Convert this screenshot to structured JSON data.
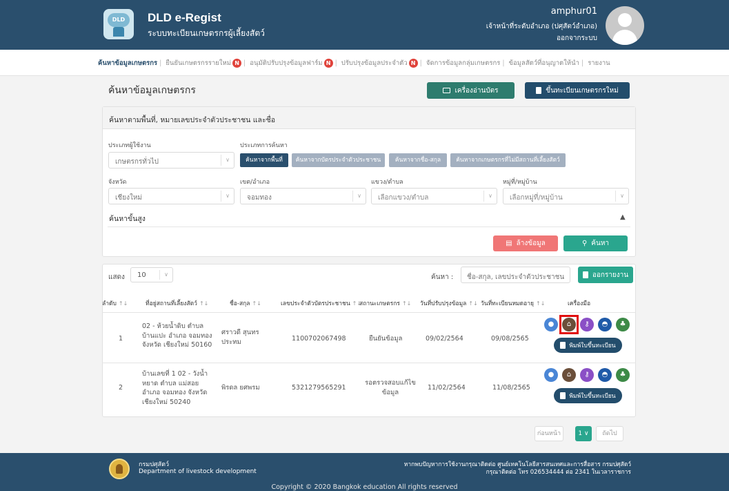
{
  "header": {
    "app_title": "DLD e-Regist",
    "app_subtitle": "ระบบทะเบียนเกษตรกรผู้เลี้ยงสัตว์",
    "logo_text": "DLD",
    "user_name": "amphur01",
    "user_role": "เจ้าหน้าที่ระดับอำเภอ (ปศุสัตว์อำเภอ)",
    "logout": "ออกจากระบบ"
  },
  "nav": {
    "items": [
      {
        "label": "ค้นหาข้อมูลเกษตรกร",
        "badge": ""
      },
      {
        "label": "ยืนยันเกษตรกรรายใหม่",
        "badge": "N"
      },
      {
        "label": "อนุมัติปรับปรุงข้อมูลฟาร์ม",
        "badge": "N"
      },
      {
        "label": "ปรับปรุงข้อมูลประจำตัว",
        "badge": "N"
      },
      {
        "label": "จัดการข้อมูลกลุ่มเกษตรกร",
        "badge": ""
      },
      {
        "label": "ข้อมูลสัตว์ที่อนุญาตให้นำ",
        "badge": ""
      },
      {
        "label": "รายงาน",
        "badge": ""
      }
    ],
    "separator": "|"
  },
  "page": {
    "title": "ค้นหาข้อมูลเกษตรกร",
    "btn_card_reader": "เครื่องอ่านบัตร",
    "btn_register_new": "ขึ้นทะเบียนเกษตรกรใหม่"
  },
  "search_panel": {
    "title": "ค้นหาตามพื้นที่, หมายเลขประจำตัวประชาชน และชื่อ",
    "user_type_label": "ประเภทผู้ใช้งาน",
    "user_type_value": "เกษตรกรทั่วไป",
    "search_type_label": "ประเภทการค้นหา",
    "search_types": [
      "ค้นหาจากพื้นที่",
      "ค้นหาจากบัตรประจำตัวประชาชน",
      "ค้นหาจากชื่อ-สกุล",
      "ค้นหาจากเกษตรกรที่ไม่มีสถานที่เลี้ยงสัตว์"
    ],
    "province_label": "จังหวัด",
    "province_value": "เชียงใหม่",
    "district_label": "เขต/อำเภอ",
    "district_value": "จอมทอง",
    "subdistrict_label": "แขวง/ตำบล",
    "subdistrict_placeholder": "เลือกแขวง/ตำบล",
    "village_label": "หมู่ที่/หมู่บ้าน",
    "village_placeholder": "เลือกหมู่ที่/หมู่บ้าน",
    "advanced_label": "ค้นหาขั้นสูง",
    "btn_clear": "ล้างข้อมูล",
    "btn_search": "ค้นหา"
  },
  "results": {
    "show_label": "แสดง",
    "rows_per_page": "10",
    "search_label": "ค้นหา :",
    "search_placeholder": "ชื่อ-สกุล, เลขประจำตัวประชาชน",
    "btn_export": "ออกรายงาน",
    "columns": [
      "ลำดับ",
      "ที่อยู่สถานที่เลี้ยงสัตว์",
      "ชื่อ-สกุล",
      "เลขประจำตัวบัตรประชาชน",
      "สถานะเกษตรกร",
      "วันที่ปรับปรุงข้อมูล",
      "วันที่ทะเบียนหมดอายุ",
      "เครื่องมือ"
    ],
    "rows": [
      {
        "no": "1",
        "address": "02 - ห้วยน้ำดิบ ตำบล บ้านแปะ อำเภอ จอมทอง จังหวัด เชียงใหม่ 50160",
        "name": "ศราวดี สุนทร ประทม",
        "id_card": "1100702067498",
        "status": "ยืนยันข้อมูล",
        "updated": "09/02/2564",
        "expires": "09/08/2565",
        "print_label": "พิมพ์ใบขึ้นทะเบียน"
      },
      {
        "no": "2",
        "address": "บ้านเลขที่ 1 02 - วังน้ำ หยาด ตำบล แม่สอย อำเภอ จอมทอง จังหวัด เชียงใหม่ 50240",
        "name": "พิรดล ยศพรม",
        "id_card": "5321279565291",
        "status": "รอตรวจสอบแก้ไข ข้อมูล",
        "updated": "11/02/2564",
        "expires": "11/08/2565",
        "print_label": "พิมพ์ใบขึ้นทะเบียน"
      }
    ],
    "sort_glyph": "↑↓"
  },
  "pagination": {
    "prev": "ก่อนหน้า",
    "current": "1",
    "next": "ถัดไป"
  },
  "footer": {
    "org_th": "กรมปศุสัตว์",
    "org_en": "Department of livestock development",
    "contact_line1": "หากพบปัญหาการใช้งานกรุณาติดต่อ ศูนย์เทคโนโลยีสารสนเทศและการสื่อสาร กรมปศุสัตว์",
    "contact_line2": "กรุณาติดต่อ โทร 026534444 ต่อ 2341 ในเวลาราชการ",
    "copyright": "Copyright © 2020 Bangkok education All rights reserved"
  },
  "colors": {
    "header": "#2a4f6d",
    "accent_green": "#2aa68e",
    "danger": "#f07676",
    "highlight": "#e10d0d"
  }
}
